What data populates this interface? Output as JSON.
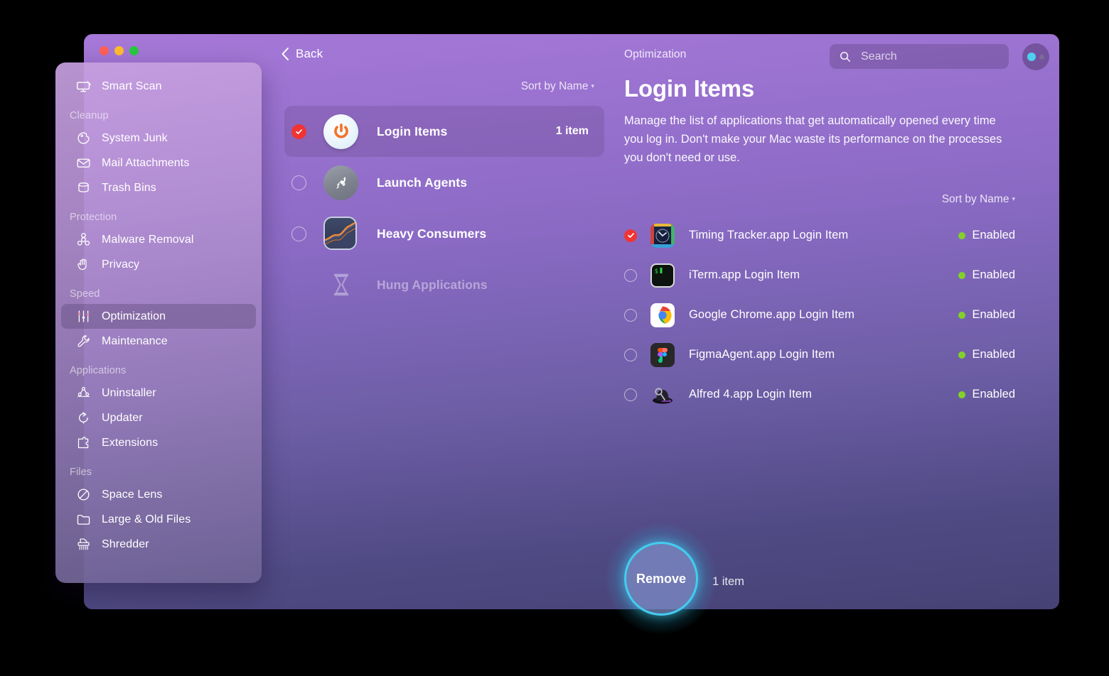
{
  "window": {
    "traffic_lights": [
      "close",
      "minimize",
      "zoom"
    ],
    "back_label": "Back",
    "section_label": "Optimization"
  },
  "search": {
    "placeholder": "Search",
    "icon": "search-icon"
  },
  "avatar": {
    "icon": "user-avatar-icon"
  },
  "middle": {
    "sort_label": "Sort by Name",
    "categories": [
      {
        "name": "Login Items",
        "count": "1 item",
        "icon": "power-icon",
        "checked": true,
        "disabled": false
      },
      {
        "name": "Launch Agents",
        "count": "",
        "icon": "rocket-icon",
        "checked": false,
        "disabled": false
      },
      {
        "name": "Heavy Consumers",
        "count": "",
        "icon": "graph-icon",
        "checked": false,
        "disabled": false
      },
      {
        "name": "Hung Applications",
        "count": "",
        "icon": "hourglass-icon",
        "checked": false,
        "disabled": true
      }
    ]
  },
  "detail": {
    "title": "Login Items",
    "description": "Manage the list of applications that get automatically opened every time you log in. Don't make your Mac waste its performance on the processes you don't need or use.",
    "sort_label": "Sort by Name",
    "items": [
      {
        "name": "Timing Tracker.app Login Item",
        "status": "Enabled",
        "icon": "timing-tracker-app-icon",
        "checked": true
      },
      {
        "name": "iTerm.app Login Item",
        "status": "Enabled",
        "icon": "iterm-app-icon",
        "checked": false
      },
      {
        "name": "Google Chrome.app Login Item",
        "status": "Enabled",
        "icon": "google-chrome-app-icon",
        "checked": false
      },
      {
        "name": "FigmaAgent.app Login Item",
        "status": "Enabled",
        "icon": "figma-app-icon",
        "checked": false
      },
      {
        "name": "Alfred 4.app Login Item",
        "status": "Enabled",
        "icon": "alfred-app-icon",
        "checked": false
      }
    ]
  },
  "sidebar": {
    "top_item": {
      "label": "Smart Scan",
      "icon": "smart-scan-icon"
    },
    "groups": [
      {
        "title": "Cleanup",
        "items": [
          {
            "label": "System Junk",
            "icon": "system-junk-icon",
            "active": false
          },
          {
            "label": "Mail Attachments",
            "icon": "mail-attachments-icon",
            "active": false
          },
          {
            "label": "Trash Bins",
            "icon": "trash-bins-icon",
            "active": false
          }
        ]
      },
      {
        "title": "Protection",
        "items": [
          {
            "label": "Malware Removal",
            "icon": "malware-removal-icon",
            "active": false
          },
          {
            "label": "Privacy",
            "icon": "privacy-hand-icon",
            "active": false
          }
        ]
      },
      {
        "title": "Speed",
        "items": [
          {
            "label": "Optimization",
            "icon": "optimization-sliders-icon",
            "active": true
          },
          {
            "label": "Maintenance",
            "icon": "maintenance-wrench-icon",
            "active": false
          }
        ]
      },
      {
        "title": "Applications",
        "items": [
          {
            "label": "Uninstaller",
            "icon": "uninstaller-icon",
            "active": false
          },
          {
            "label": "Updater",
            "icon": "updater-icon",
            "active": false
          },
          {
            "label": "Extensions",
            "icon": "extensions-icon",
            "active": false
          }
        ]
      },
      {
        "title": "Files",
        "items": [
          {
            "label": "Space Lens",
            "icon": "space-lens-icon",
            "active": false
          },
          {
            "label": "Large & Old Files",
            "icon": "large-old-files-icon",
            "active": false
          },
          {
            "label": "Shredder",
            "icon": "shredder-icon",
            "active": false
          }
        ]
      }
    ]
  },
  "footer": {
    "remove_label": "Remove",
    "count_label": "1 item"
  },
  "colors": {
    "accent_red": "#f03434",
    "accent_cyan": "#43cdf0",
    "status_green": "#82d12b",
    "window_top": "#a678d8",
    "window_bottom": "#464275"
  }
}
